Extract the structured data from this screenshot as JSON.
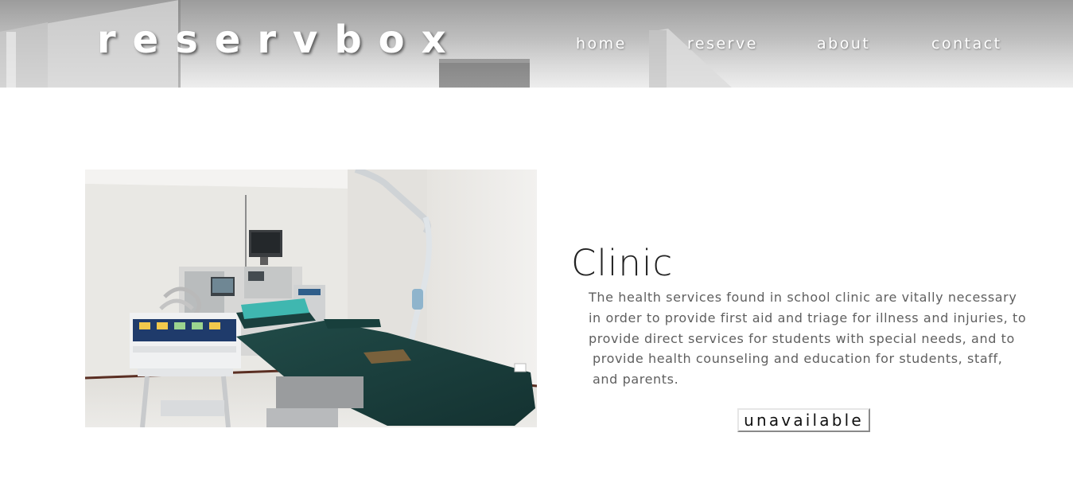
{
  "header": {
    "logo": "reservbox",
    "nav": [
      {
        "label": "home"
      },
      {
        "label": "reserve"
      },
      {
        "label": "about"
      },
      {
        "label": "contact"
      }
    ]
  },
  "room": {
    "title": "Clinic",
    "description_lines": [
      "The health services found in school clinic are vitally necessary",
      "in order to provide first aid and triage for illness and injuries, to",
      "provide direct services for students with special needs, and to",
      "provide health counseling and education for students, staff,",
      "and parents."
    ],
    "status_button": "unavailable"
  },
  "colors": {
    "header_gradient_top": "#9c9c9c",
    "header_gradient_bottom": "#e4e4e4",
    "logo_text": "#ffffff",
    "title_text": "#222222",
    "description_text": "#5f5f5f",
    "mattress": "#1c3d3b",
    "pillow": "#3fb7b0"
  }
}
